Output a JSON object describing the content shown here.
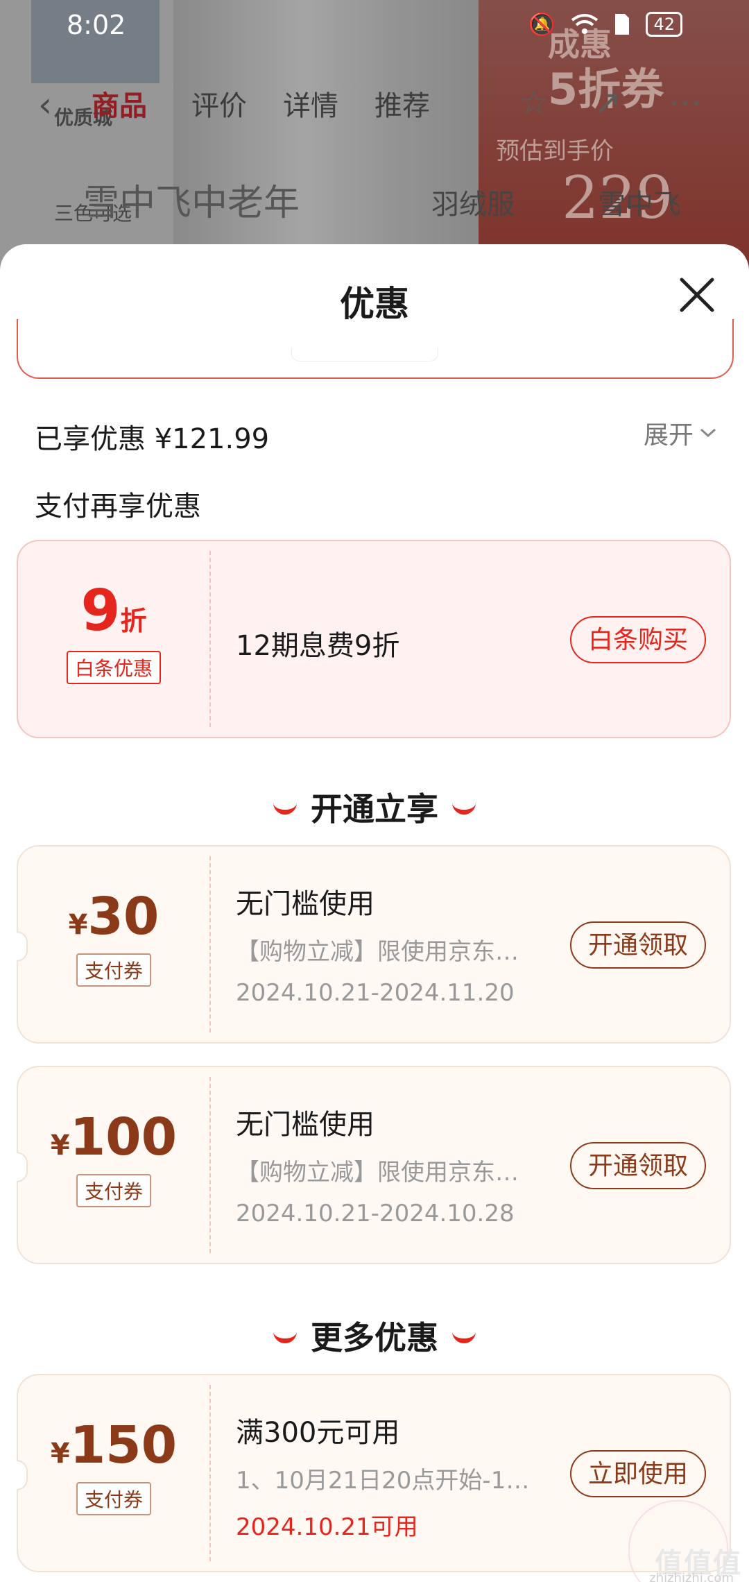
{
  "status": {
    "time": "8:02",
    "battery": "42"
  },
  "background": {
    "tabs": [
      "商品",
      "评价",
      "详情",
      "推荐"
    ],
    "badge": "优质城",
    "colors_label": "三色可选",
    "search_text": "雪中飞中老年",
    "keyword1": "羽绒服",
    "keyword2": "雪中飞",
    "promo_line1": "成惠",
    "promo_line2": "5折券",
    "promo_line3": "预估到手价",
    "promo_price": "229"
  },
  "sheet": {
    "title": "优惠",
    "saved_label": "已享优惠 ¥121.99",
    "expand_label": "展开",
    "pay_more_label": "支付再享优惠",
    "baitiao": {
      "discount": "9",
      "discount_unit": "折",
      "tag": "白条优惠",
      "text": "12期息费9折",
      "button": "白条购买"
    },
    "section_open": "开通立享",
    "section_more": "更多优惠",
    "coupons": [
      {
        "symbol": "¥",
        "amount": "30",
        "tag": "支付券",
        "title": "无门槛使用",
        "desc": "【购物立减】限使用京东…",
        "date": "2024.10.21-2024.11.20",
        "button": "开通领取"
      },
      {
        "symbol": "¥",
        "amount": "100",
        "tag": "支付券",
        "title": "无门槛使用",
        "desc": "【购物立减】限使用京东…",
        "date": "2024.10.21-2024.10.28",
        "button": "开通领取"
      },
      {
        "symbol": "¥",
        "amount": "150",
        "tag": "支付券",
        "title": "满300元可用",
        "desc": "1、10月21日20点开始-1…",
        "date": "2024.10.21可用",
        "button": "立即使用"
      }
    ]
  },
  "watermark": {
    "text": "值值值",
    "sub": "zhizhizhi.com"
  },
  "colors": {
    "accent_red": "#e5261d",
    "coupon_brown": "#8a3a18"
  }
}
